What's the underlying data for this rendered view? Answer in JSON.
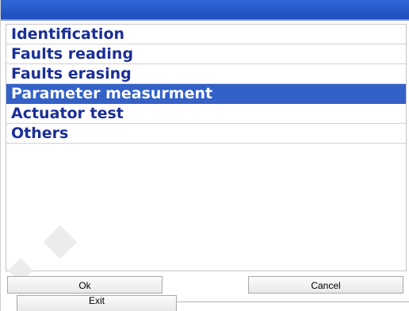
{
  "menu": {
    "items": [
      {
        "label": "Identification"
      },
      {
        "label": "Faults reading"
      },
      {
        "label": "Faults erasing"
      },
      {
        "label": "Parameter measurment",
        "selected": true
      },
      {
        "label": "Actuator test"
      },
      {
        "label": "Others"
      }
    ]
  },
  "buttons": {
    "ok_label": "Ok",
    "cancel_label": "Cancel",
    "exit_label": "Exit"
  },
  "colors": {
    "titlebar": "#1f4fbe",
    "item_text": "#1b2f96",
    "selection": "#3361c7"
  }
}
